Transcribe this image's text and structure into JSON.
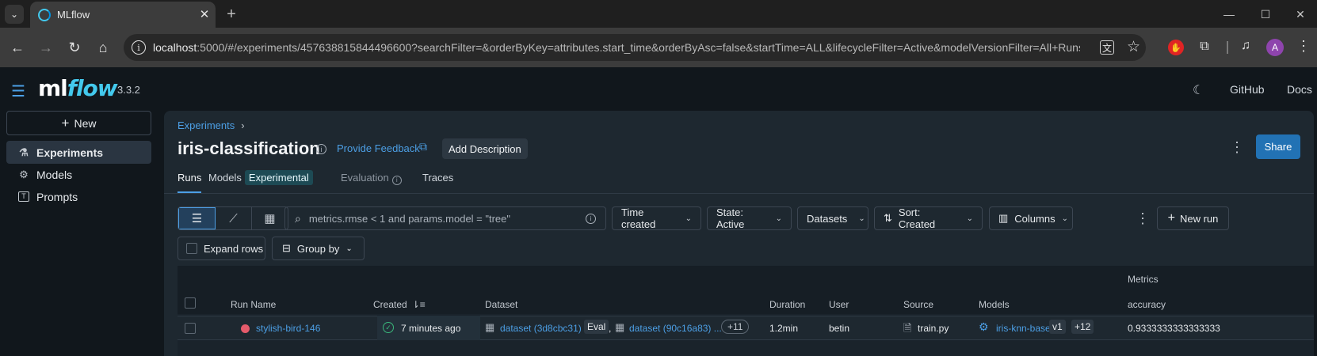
{
  "browser": {
    "tab_title": "MLflow",
    "url_host": "localhost",
    "url_rest": ":5000/#/experiments/457638815844496600?searchFilter=&orderByKey=attributes.start_time&orderByAsc=false&startTime=ALL&lifecycleFilter=Active&modelVersionFilter=All+Runs...",
    "profile_initial": "A"
  },
  "app": {
    "logo_ml": "ml",
    "logo_flow": "flow",
    "version": "3.3.2",
    "github_label": "GitHub",
    "docs_label": "Docs"
  },
  "sidebar": {
    "new_label": "New",
    "items": [
      {
        "label": "Experiments",
        "icon": "flask-icon",
        "active": true
      },
      {
        "label": "Models",
        "icon": "models-icon",
        "active": false
      },
      {
        "label": "Prompts",
        "icon": "prompt-icon",
        "active": false
      }
    ]
  },
  "experiment": {
    "breadcrumb": "Experiments",
    "title": "iris-classification",
    "feedback_label": "Provide Feedback",
    "add_description_label": "Add Description",
    "share_label": "Share"
  },
  "tabs": {
    "runs": "Runs",
    "models": "Models",
    "models_badge": "Experimental",
    "evaluation": "Evaluation",
    "traces": "Traces"
  },
  "controls": {
    "search_placeholder": "metrics.rmse < 1 and params.model = \"tree\"",
    "time_created": "Time created",
    "state": "State: Active",
    "datasets": "Datasets",
    "sort": "Sort: Created",
    "columns": "Columns",
    "new_run": "New run",
    "expand_rows": "Expand rows",
    "group_by": "Group by"
  },
  "table": {
    "group_header": "Metrics",
    "headers": {
      "run_name": "Run Name",
      "created": "Created",
      "dataset": "Dataset",
      "duration": "Duration",
      "user": "User",
      "source": "Source",
      "models": "Models",
      "accuracy": "accuracy"
    },
    "row": {
      "run_name": "stylish-bird-146",
      "created": "7 minutes ago",
      "dataset1": "dataset (3d8cbc31)",
      "dataset1_tag": "Eval",
      "dataset_sep": ",",
      "dataset2": "dataset (90c16a83) ...",
      "dataset_more": "+11",
      "duration": "1.2min",
      "user": "betin",
      "source": "train.py",
      "model_name": "iris-knn-base",
      "model_version": "v1",
      "models_more": "+12",
      "accuracy": "0.9333333333333333"
    }
  }
}
